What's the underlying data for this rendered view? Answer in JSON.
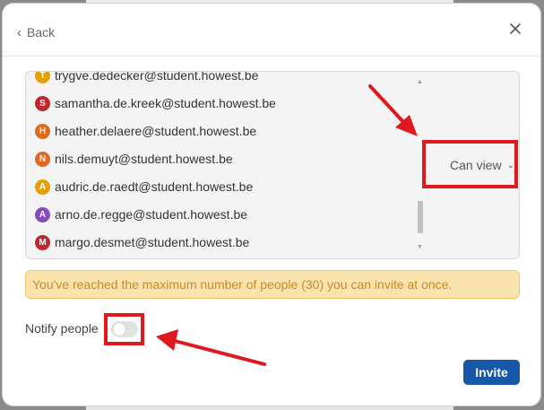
{
  "header": {
    "back_label": "Back"
  },
  "people": [
    {
      "initial": "T",
      "email": "trygve.dedecker@student.howest.be",
      "color": "#e3a008"
    },
    {
      "initial": "S",
      "email": "samantha.de.kreek@student.howest.be",
      "color": "#c0262d"
    },
    {
      "initial": "H",
      "email": "heather.delaere@student.howest.be",
      "color": "#e2691f"
    },
    {
      "initial": "N",
      "email": "nils.demuyt@student.howest.be",
      "color": "#e2691f"
    },
    {
      "initial": "A",
      "email": "audric.de.raedt@student.howest.be",
      "color": "#e3a008"
    },
    {
      "initial": "A",
      "email": "arno.de.regge@student.howest.be",
      "color": "#8a4bbf"
    },
    {
      "initial": "M",
      "email": "margo.desmet@student.howest.be",
      "color": "#c0262d"
    }
  ],
  "permission": {
    "label": "Can view"
  },
  "warning": {
    "text": "You've reached the maximum number of people (30) you can invite at once."
  },
  "notify": {
    "label": "Notify people"
  },
  "footer": {
    "invite_label": "Invite"
  },
  "colors": {
    "annotation": "#e0191e",
    "primary": "#1658a7",
    "warning_bg": "#fbe3ad"
  }
}
